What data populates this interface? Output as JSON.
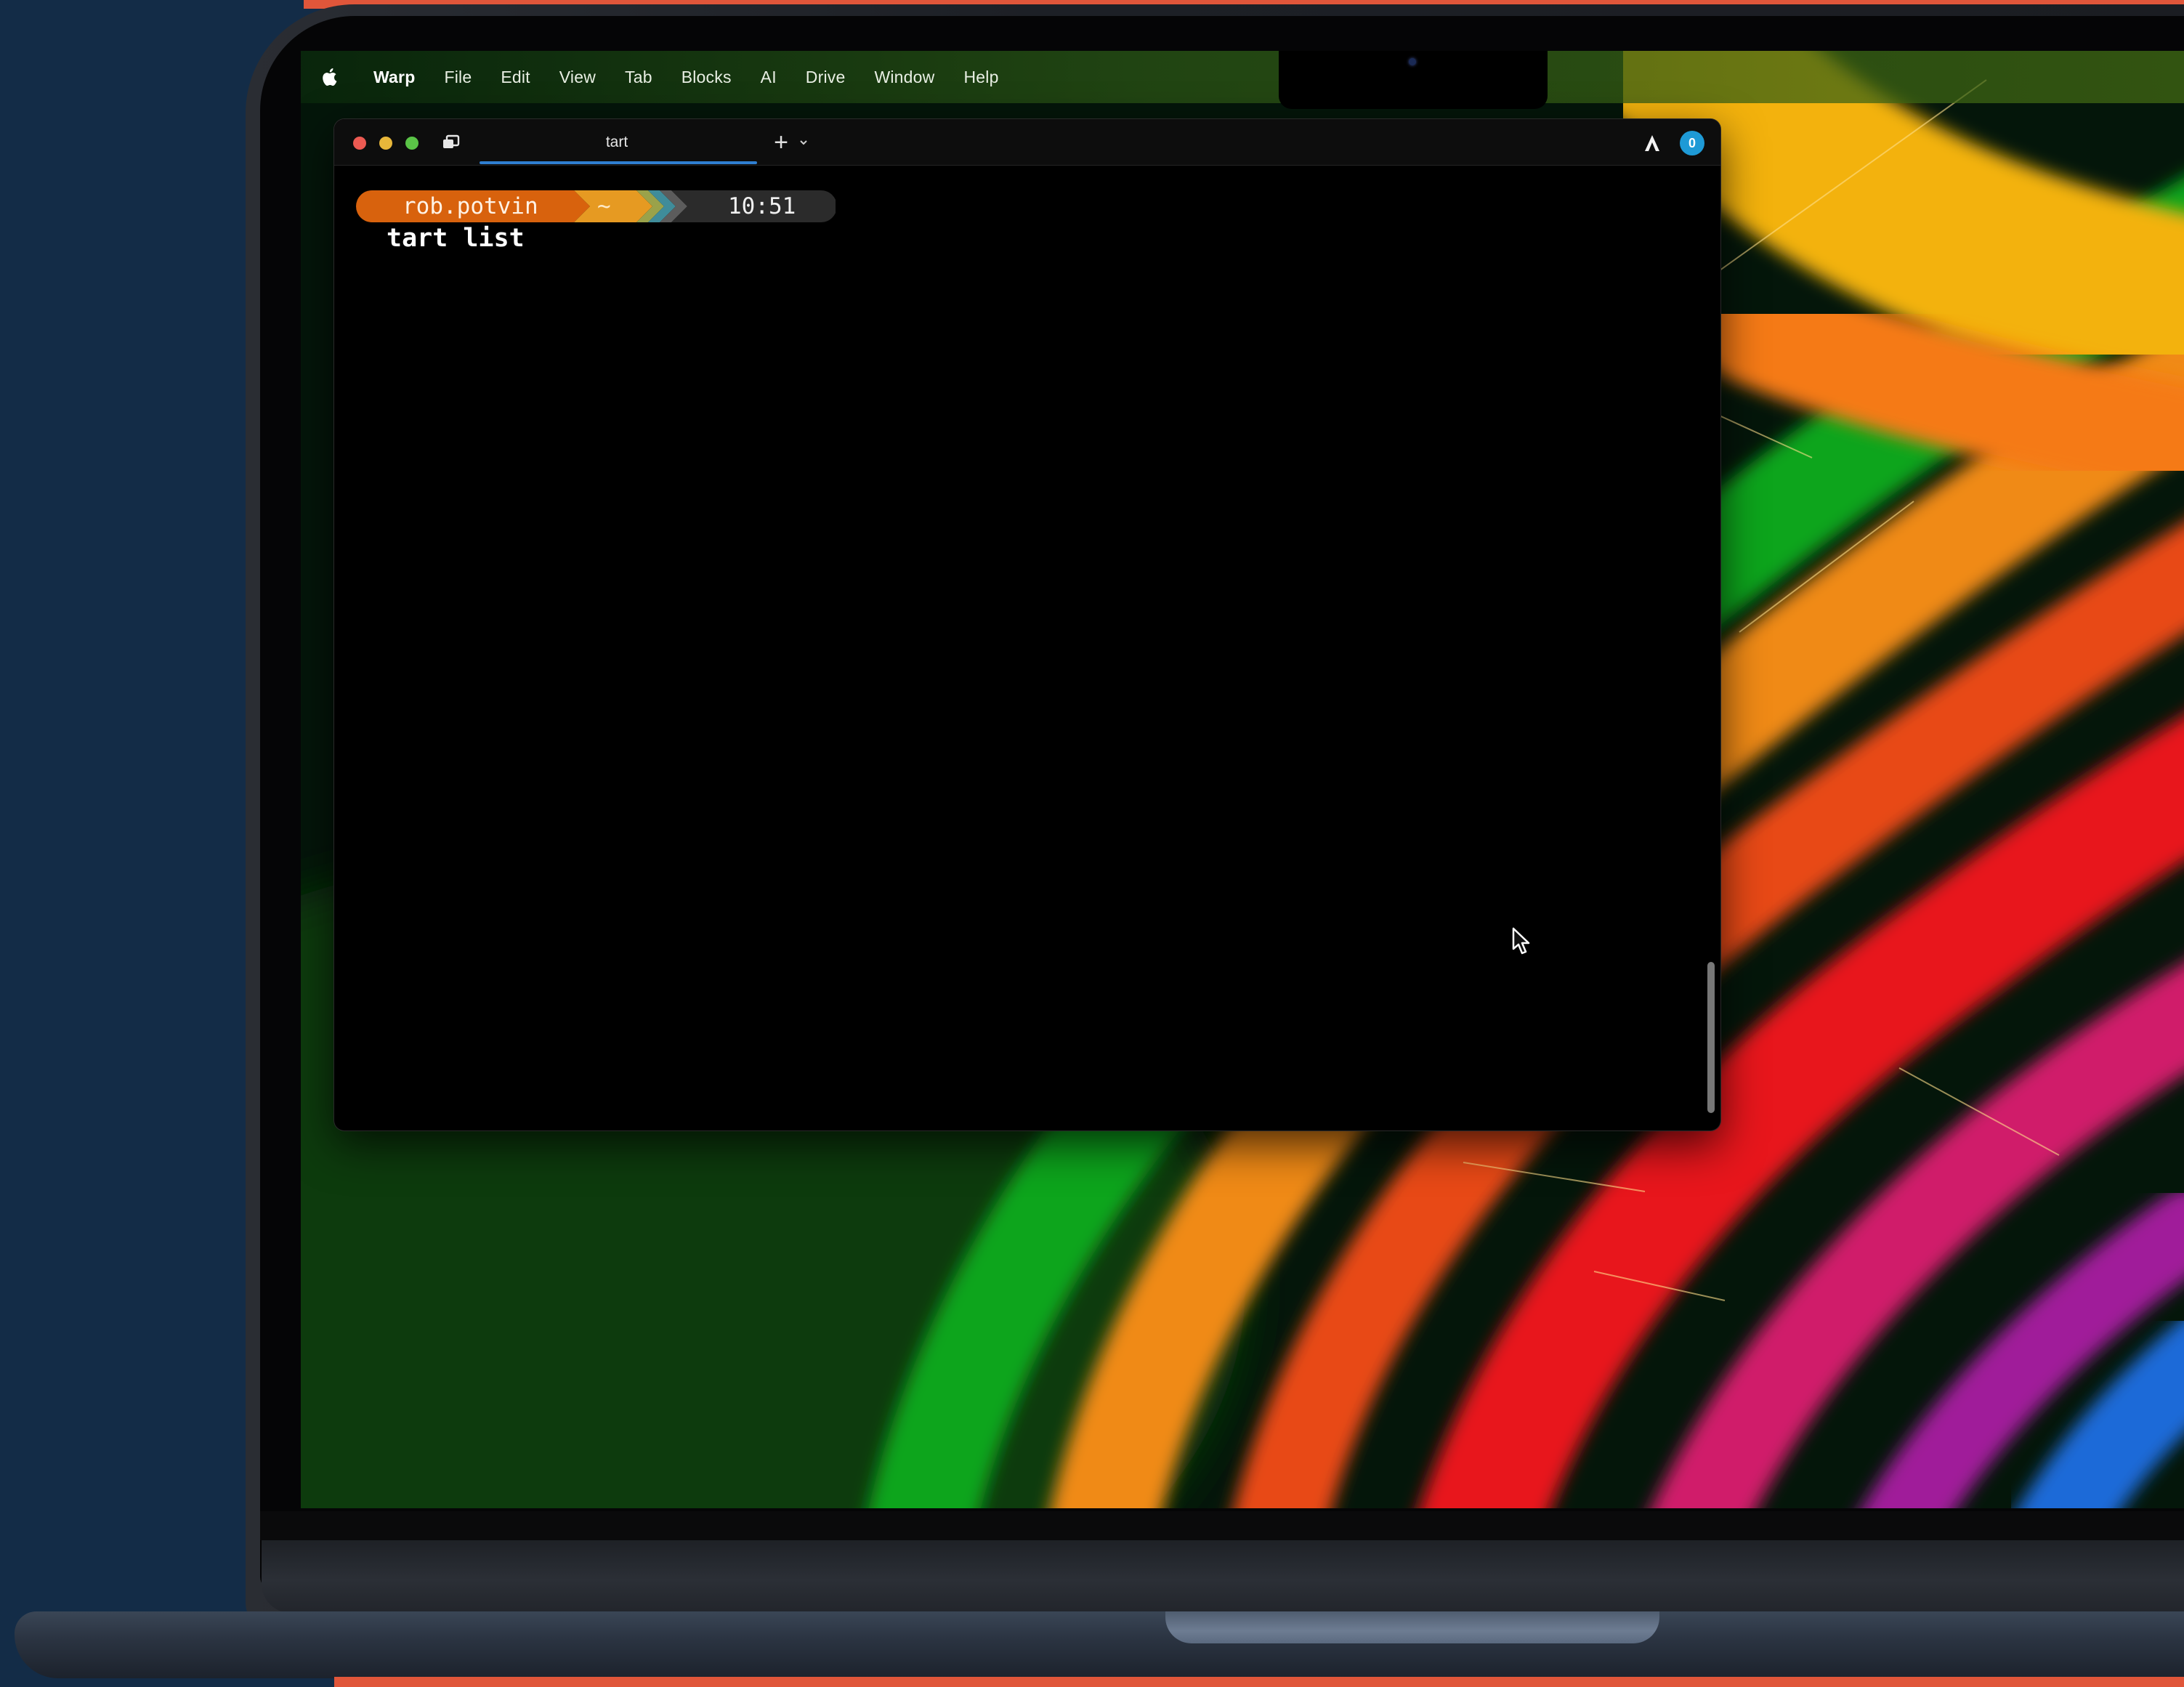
{
  "menubar": {
    "items": [
      "Warp",
      "File",
      "Edit",
      "View",
      "Tab",
      "Blocks",
      "AI",
      "Drive",
      "Window",
      "Help"
    ]
  },
  "window": {
    "tab_title": "tart",
    "new_tab_symbol": "+",
    "avatar_letter": "0"
  },
  "prompt": {
    "user": "rob.potvin",
    "dir": "~",
    "time": "10:51"
  },
  "command": "tart list",
  "icons": [
    "apple-logo-icon",
    "split-pane-icon",
    "plus-icon",
    "chevron-down-icon",
    "warp-logo-icon",
    "mouse-cursor-icon"
  ],
  "colors": {
    "accent": "#e0563a",
    "prompt_user_bg": "#d8620d",
    "prompt_dir_bg": "#e69a22",
    "prompt_time_bg": "#2b2b2b",
    "tab_underline": "#2f7fd1"
  }
}
